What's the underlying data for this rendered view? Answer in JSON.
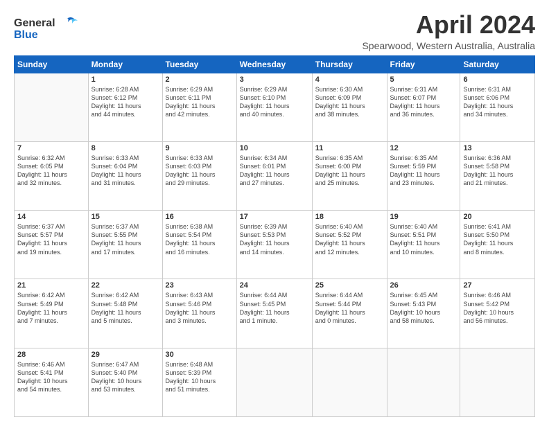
{
  "logo": {
    "line1": "General",
    "line2": "Blue"
  },
  "title": "April 2024",
  "subtitle": "Spearwood, Western Australia, Australia",
  "days_header": [
    "Sunday",
    "Monday",
    "Tuesday",
    "Wednesday",
    "Thursday",
    "Friday",
    "Saturday"
  ],
  "weeks": [
    [
      {
        "num": "",
        "info": ""
      },
      {
        "num": "1",
        "info": "Sunrise: 6:28 AM\nSunset: 6:12 PM\nDaylight: 11 hours\nand 44 minutes."
      },
      {
        "num": "2",
        "info": "Sunrise: 6:29 AM\nSunset: 6:11 PM\nDaylight: 11 hours\nand 42 minutes."
      },
      {
        "num": "3",
        "info": "Sunrise: 6:29 AM\nSunset: 6:10 PM\nDaylight: 11 hours\nand 40 minutes."
      },
      {
        "num": "4",
        "info": "Sunrise: 6:30 AM\nSunset: 6:09 PM\nDaylight: 11 hours\nand 38 minutes."
      },
      {
        "num": "5",
        "info": "Sunrise: 6:31 AM\nSunset: 6:07 PM\nDaylight: 11 hours\nand 36 minutes."
      },
      {
        "num": "6",
        "info": "Sunrise: 6:31 AM\nSunset: 6:06 PM\nDaylight: 11 hours\nand 34 minutes."
      }
    ],
    [
      {
        "num": "7",
        "info": "Sunrise: 6:32 AM\nSunset: 6:05 PM\nDaylight: 11 hours\nand 32 minutes."
      },
      {
        "num": "8",
        "info": "Sunrise: 6:33 AM\nSunset: 6:04 PM\nDaylight: 11 hours\nand 31 minutes."
      },
      {
        "num": "9",
        "info": "Sunrise: 6:33 AM\nSunset: 6:03 PM\nDaylight: 11 hours\nand 29 minutes."
      },
      {
        "num": "10",
        "info": "Sunrise: 6:34 AM\nSunset: 6:01 PM\nDaylight: 11 hours\nand 27 minutes."
      },
      {
        "num": "11",
        "info": "Sunrise: 6:35 AM\nSunset: 6:00 PM\nDaylight: 11 hours\nand 25 minutes."
      },
      {
        "num": "12",
        "info": "Sunrise: 6:35 AM\nSunset: 5:59 PM\nDaylight: 11 hours\nand 23 minutes."
      },
      {
        "num": "13",
        "info": "Sunrise: 6:36 AM\nSunset: 5:58 PM\nDaylight: 11 hours\nand 21 minutes."
      }
    ],
    [
      {
        "num": "14",
        "info": "Sunrise: 6:37 AM\nSunset: 5:57 PM\nDaylight: 11 hours\nand 19 minutes."
      },
      {
        "num": "15",
        "info": "Sunrise: 6:37 AM\nSunset: 5:55 PM\nDaylight: 11 hours\nand 17 minutes."
      },
      {
        "num": "16",
        "info": "Sunrise: 6:38 AM\nSunset: 5:54 PM\nDaylight: 11 hours\nand 16 minutes."
      },
      {
        "num": "17",
        "info": "Sunrise: 6:39 AM\nSunset: 5:53 PM\nDaylight: 11 hours\nand 14 minutes."
      },
      {
        "num": "18",
        "info": "Sunrise: 6:40 AM\nSunset: 5:52 PM\nDaylight: 11 hours\nand 12 minutes."
      },
      {
        "num": "19",
        "info": "Sunrise: 6:40 AM\nSunset: 5:51 PM\nDaylight: 11 hours\nand 10 minutes."
      },
      {
        "num": "20",
        "info": "Sunrise: 6:41 AM\nSunset: 5:50 PM\nDaylight: 11 hours\nand 8 minutes."
      }
    ],
    [
      {
        "num": "21",
        "info": "Sunrise: 6:42 AM\nSunset: 5:49 PM\nDaylight: 11 hours\nand 7 minutes."
      },
      {
        "num": "22",
        "info": "Sunrise: 6:42 AM\nSunset: 5:48 PM\nDaylight: 11 hours\nand 5 minutes."
      },
      {
        "num": "23",
        "info": "Sunrise: 6:43 AM\nSunset: 5:46 PM\nDaylight: 11 hours\nand 3 minutes."
      },
      {
        "num": "24",
        "info": "Sunrise: 6:44 AM\nSunset: 5:45 PM\nDaylight: 11 hours\nand 1 minute."
      },
      {
        "num": "25",
        "info": "Sunrise: 6:44 AM\nSunset: 5:44 PM\nDaylight: 11 hours\nand 0 minutes."
      },
      {
        "num": "26",
        "info": "Sunrise: 6:45 AM\nSunset: 5:43 PM\nDaylight: 10 hours\nand 58 minutes."
      },
      {
        "num": "27",
        "info": "Sunrise: 6:46 AM\nSunset: 5:42 PM\nDaylight: 10 hours\nand 56 minutes."
      }
    ],
    [
      {
        "num": "28",
        "info": "Sunrise: 6:46 AM\nSunset: 5:41 PM\nDaylight: 10 hours\nand 54 minutes."
      },
      {
        "num": "29",
        "info": "Sunrise: 6:47 AM\nSunset: 5:40 PM\nDaylight: 10 hours\nand 53 minutes."
      },
      {
        "num": "30",
        "info": "Sunrise: 6:48 AM\nSunset: 5:39 PM\nDaylight: 10 hours\nand 51 minutes."
      },
      {
        "num": "",
        "info": ""
      },
      {
        "num": "",
        "info": ""
      },
      {
        "num": "",
        "info": ""
      },
      {
        "num": "",
        "info": ""
      }
    ]
  ]
}
